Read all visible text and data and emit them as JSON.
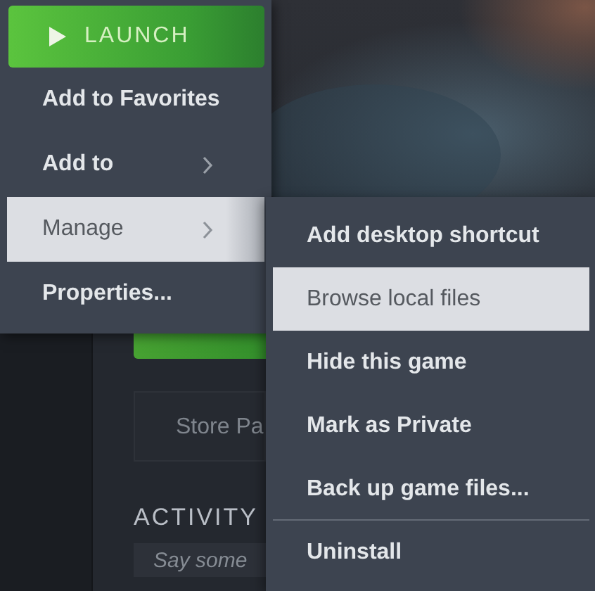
{
  "background": {
    "store_button": "Store Pa",
    "activity_heading": "ACTIVITY",
    "comment_field": {
      "placeholder": "Say some"
    }
  },
  "menu": {
    "launch": "LAUNCH",
    "items": [
      {
        "label": "Add to Favorites",
        "has_submenu": false,
        "selected": false
      },
      {
        "label": "Add to",
        "has_submenu": true,
        "selected": false
      },
      {
        "label": "Manage",
        "has_submenu": true,
        "selected": true
      },
      {
        "label": "Properties...",
        "has_submenu": false,
        "selected": false
      }
    ]
  },
  "submenu": {
    "items": [
      {
        "label": "Add desktop shortcut",
        "selected": false,
        "separator_before": false
      },
      {
        "label": "Browse local files",
        "selected": true,
        "separator_before": false
      },
      {
        "label": "Hide this game",
        "selected": false,
        "separator_before": false
      },
      {
        "label": "Mark as Private",
        "selected": false,
        "separator_before": false
      },
      {
        "label": "Back up game files...",
        "selected": false,
        "separator_before": false
      },
      {
        "label": "Uninstall",
        "selected": false,
        "separator_before": true
      }
    ]
  }
}
